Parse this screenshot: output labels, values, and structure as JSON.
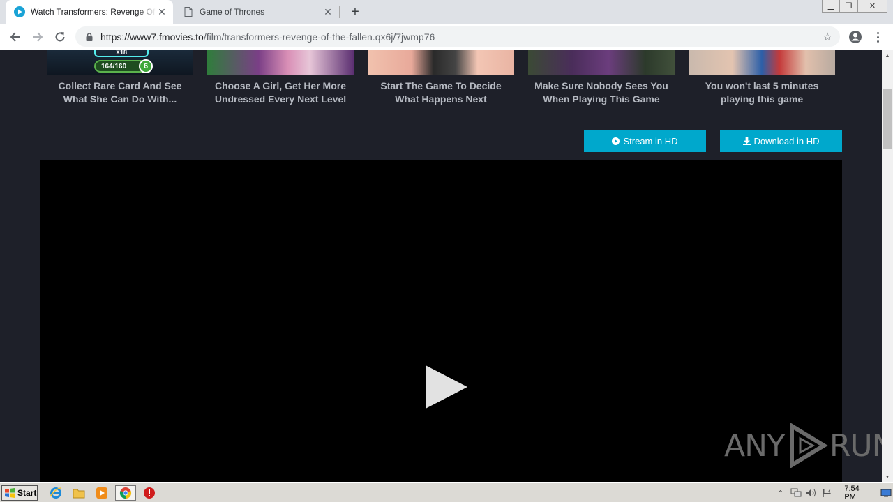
{
  "browser": {
    "tabs": [
      {
        "title": "Watch Transformers: Revenge Of The Fallen",
        "active": true
      },
      {
        "title": "Game of Thrones",
        "active": false
      }
    ],
    "new_tab": "+",
    "url_host": "https://www7.fmovies.to",
    "url_path": "/film/transformers-revenge-of-the-fallen.qx6j/7jwmp76"
  },
  "ads": [
    {
      "caption_1": "Collect Rare Card And See",
      "caption_2": "What She Can Do With...",
      "badge_x": "X18",
      "badge_score": "164/160",
      "badge_level": "6"
    },
    {
      "caption_1": "Choose A Girl, Get Her More",
      "caption_2": "Undressed Every Next Level"
    },
    {
      "caption_1": "Start The Game To Decide",
      "caption_2": "What Happens Next"
    },
    {
      "caption_1": "Make Sure Nobody Sees You",
      "caption_2": "When Playing This Game"
    },
    {
      "caption_1": "You won't last 5 minutes",
      "caption_2": "playing this game"
    }
  ],
  "buttons": {
    "stream": "Stream in HD",
    "download": "Download in HD"
  },
  "watermark": {
    "left": "ANY",
    "right": "RUN"
  },
  "taskbar": {
    "start": "Start",
    "clock": "7:54 PM"
  },
  "colors": {
    "page_bg": "#1e2029",
    "button": "#00a8cc",
    "caption": "#b5b9c1"
  }
}
